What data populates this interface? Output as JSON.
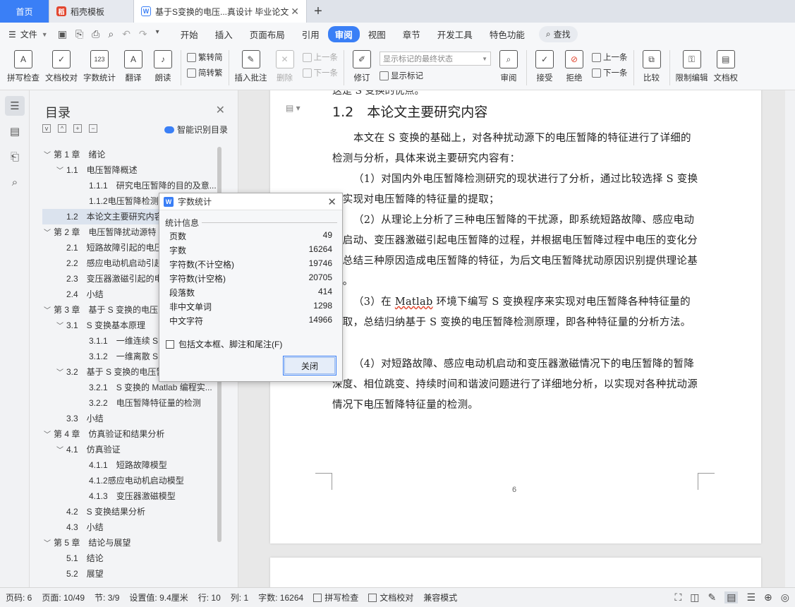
{
  "tabs": {
    "home": "首页",
    "template": "稻壳模板",
    "doc": "基于S变换的电压...真设计 毕业论文",
    "add": "+"
  },
  "menu": {
    "file": "文件",
    "items": [
      "开始",
      "插入",
      "页面布局",
      "引用",
      "审阅",
      "视图",
      "章节",
      "开发工具",
      "特色功能"
    ],
    "active_index": 4,
    "search": "查找"
  },
  "ribbon": {
    "spell": "拼写检查",
    "proof": "文档校对",
    "wordcount": "字数统计",
    "translate": "翻译",
    "read": "朗读",
    "trad": "繁转简",
    "simp": "简转繁",
    "insert_comment": "插入批注",
    "delete": "删除",
    "prev": "上一条",
    "next": "下一条",
    "revise": "修订",
    "markup_select": "显示标记的最终状态",
    "show_markup": "显示标记",
    "review": "审阅",
    "accept": "接受",
    "reject": "拒绝",
    "prev2": "上一条",
    "next2": "下一条",
    "compare": "比较",
    "restrict": "限制编辑",
    "docperm": "文档权"
  },
  "toc": {
    "title": "目录",
    "smart": "智能识别目录",
    "items": [
      {
        "level": 1,
        "text": "第 1 章　绪论",
        "arrow": "v"
      },
      {
        "level": 2,
        "text": "1.1　电压暂降概述",
        "arrow": "v"
      },
      {
        "level": 3,
        "text": "1.1.1　研究电压暂降的目的及意..."
      },
      {
        "level": 3,
        "text": "1.1.2电压暂降检测的"
      },
      {
        "level": 2,
        "text": "1.2　本论文主要研究内容",
        "selected": true
      },
      {
        "level": 1,
        "text": "第 2 章　电压暂降扰动源特",
        "arrow": "v"
      },
      {
        "level": 2,
        "text": "2.1　短路故障引起的电压"
      },
      {
        "level": 2,
        "text": "2.2　感应电动机启动引起"
      },
      {
        "level": 2,
        "text": "2.3　变压器激磁引起的电"
      },
      {
        "level": 2,
        "text": "2.4　小结"
      },
      {
        "level": 1,
        "text": "第 3 章　基于 S 变换的电压",
        "arrow": "v"
      },
      {
        "level": 2,
        "text": "3.1　S 变换基本原理",
        "arrow": "v"
      },
      {
        "level": 3,
        "text": "3.1.1　一维连续 S 变"
      },
      {
        "level": 3,
        "text": "3.1.2　一维离散 S 变"
      },
      {
        "level": 2,
        "text": "3.2　基于 S 变换的电压暂",
        "arrow": "v"
      },
      {
        "level": 3,
        "text": "3.2.1　S 变换的 Matlab 编程实..."
      },
      {
        "level": 3,
        "text": "3.2.2　电压暂降特征量的检测"
      },
      {
        "level": 2,
        "text": "3.3　小结"
      },
      {
        "level": 1,
        "text": "第 4 章　仿真验证和结果分析",
        "arrow": "v"
      },
      {
        "level": 2,
        "text": "4.1　仿真验证",
        "arrow": "v"
      },
      {
        "level": 3,
        "text": "4.1.1　短路故障模型"
      },
      {
        "level": 3,
        "text": "4.1.2感应电动机启动模型"
      },
      {
        "level": 3,
        "text": "4.1.3　变压器激磁模型"
      },
      {
        "level": 2,
        "text": "4.2　S 变换结果分析"
      },
      {
        "level": 2,
        "text": "4.3　小结"
      },
      {
        "level": 1,
        "text": "第 5 章　结论与展望",
        "arrow": "v"
      },
      {
        "level": 2,
        "text": "5.1　结论"
      },
      {
        "level": 2,
        "text": "5.2　展望"
      }
    ]
  },
  "document": {
    "fragment": "这是 S 变换的优点。",
    "heading": "1.2　本论文主要研究内容",
    "p1": "本文在 S 变换的基础上，对各种扰动源下的电压暂降的特征进行了详细的检测与分析，具体来说主要研究内容有：",
    "p2": "（1）对国内外电压暂降检测研究的现状进行了分析，通过比较选择 S 变换来实现对电压暂降的特征量的提取；",
    "p3": "（2）从理论上分析了三种电压暂降的干扰源，即系统短路故障、感应电动机启动、变压器激磁引起电压暂降的过程，并根据电压暂降过程中电压的变化分析总结三种原因造成电压暂降的特征，为后文电压暂降扰动原因识别提供理论基础。",
    "p4a": "（3）在 ",
    "p4b": "Matlab",
    "p4c": " 环境下编写 S 变换程序来实现对电压暂降各种特征量的提取，总结归纳基于 S 变换的电压暂降检测原理，即各种特征量的分析方法。",
    "p5": "（4）对短路故障、感应电动机启动和变压器激磁情况下的电压暂降的暂降深度、相位跳变、持续时间和谐波问题进行了详细地分析，以实现对各种扰动源情况下电压暂降特征量的检测。",
    "page_number": "6"
  },
  "dialog": {
    "title": "字数统计",
    "section": "统计信息",
    "rows": [
      {
        "label": "页数",
        "value": "49"
      },
      {
        "label": "字数",
        "value": "16264"
      },
      {
        "label": "字符数(不计空格)",
        "value": "19746"
      },
      {
        "label": "字符数(计空格)",
        "value": "20705"
      },
      {
        "label": "段落数",
        "value": "414"
      },
      {
        "label": "非中文单词",
        "value": "1298"
      },
      {
        "label": "中文字符",
        "value": "14966"
      }
    ],
    "checkbox": "包括文本框、脚注和尾注(F)",
    "close": "关闭"
  },
  "status": {
    "page": "页码: 6",
    "pages": "页面: 10/49",
    "section": "节: 3/9",
    "setting": "设置值: 9.4厘米",
    "row": "行: 10",
    "col": "列: 1",
    "words": "字数: 16264",
    "spell": "拼写检查",
    "proof": "文档校对",
    "compat": "兼容模式"
  }
}
